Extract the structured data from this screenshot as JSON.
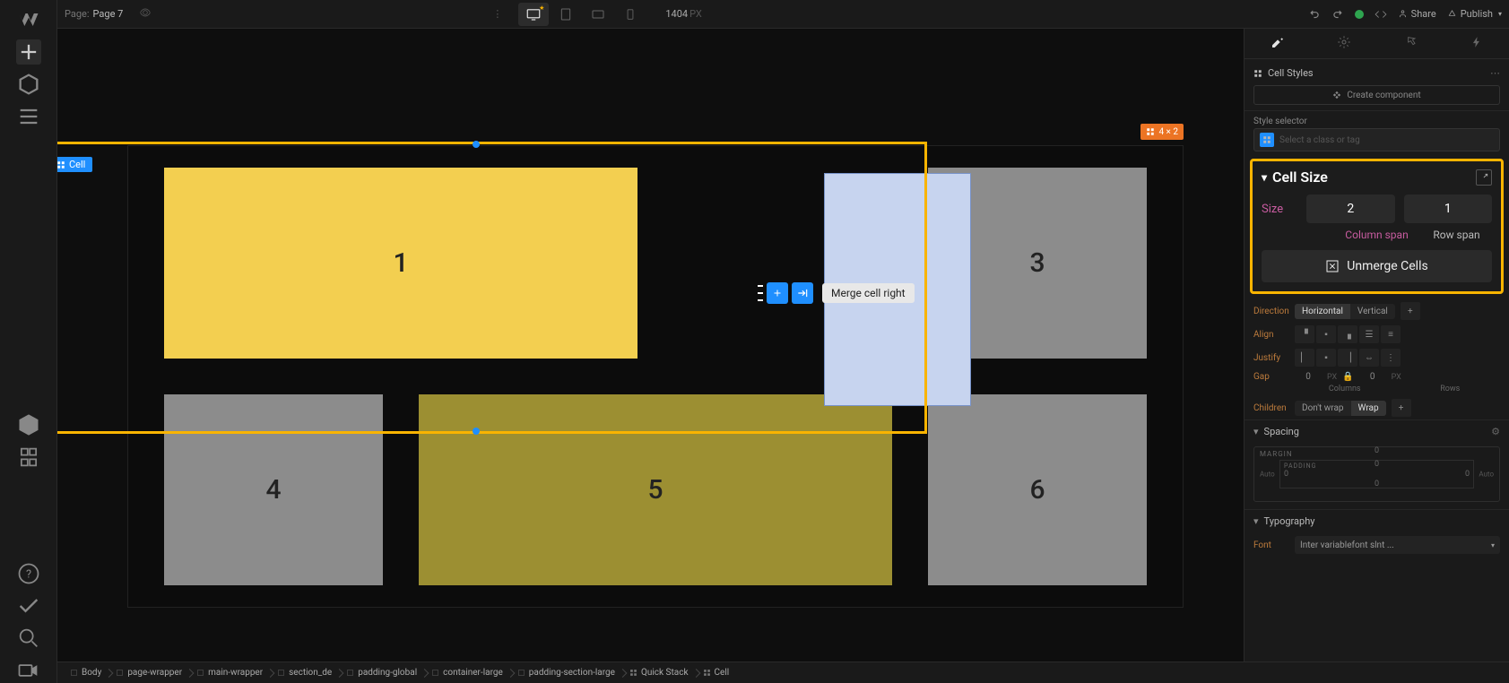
{
  "top": {
    "page_label": "Page:",
    "page_name": "Page 7",
    "viewport_value": "1404",
    "viewport_unit": "PX",
    "share": "Share",
    "publish": "Publish"
  },
  "canvas": {
    "sel_tag": "Cell",
    "grid_badge": "4 × 2",
    "cells": {
      "c1": "1",
      "c3": "3",
      "c4": "4",
      "c5": "5",
      "c6": "6"
    },
    "tooltip": "Merge cell right"
  },
  "right": {
    "cell_styles": "Cell Styles",
    "create_component": "Create component",
    "style_selector_label": "Style selector",
    "style_selector_ph": "Select a class or tag",
    "cell_size": {
      "title": "Cell Size",
      "size_lbl": "Size",
      "col_val": "2",
      "row_val": "1",
      "col_lbl": "Column span",
      "row_lbl": "Row span",
      "unmerge": "Unmerge Cells"
    },
    "direction": {
      "lbl": "Direction",
      "horizontal": "Horizontal",
      "vertical": "Vertical"
    },
    "align_lbl": "Align",
    "justify_lbl": "Justify",
    "gap": {
      "lbl": "Gap",
      "col_val": "0",
      "col_unit": "PX",
      "row_val": "0",
      "row_unit": "PX",
      "cols": "Columns",
      "rows": "Rows"
    },
    "children": {
      "lbl": "Children",
      "nowrap": "Don't wrap",
      "wrap": "Wrap"
    },
    "spacing": {
      "title": "Spacing",
      "margin": "MARGIN",
      "padding": "PADDING",
      "pt": "0",
      "pb": "0",
      "pl": "0",
      "pr": "0",
      "mt": "0",
      "auto_l": "Auto",
      "auto_r": "Auto"
    },
    "typography": {
      "title": "Typography",
      "font_lbl": "Font",
      "font_val": "Inter variablefont slnt ..."
    }
  },
  "breadcrumbs": [
    "Body",
    "page-wrapper",
    "main-wrapper",
    "section_de",
    "padding-global",
    "container-large",
    "padding-section-large",
    "Quick Stack",
    "Cell"
  ]
}
